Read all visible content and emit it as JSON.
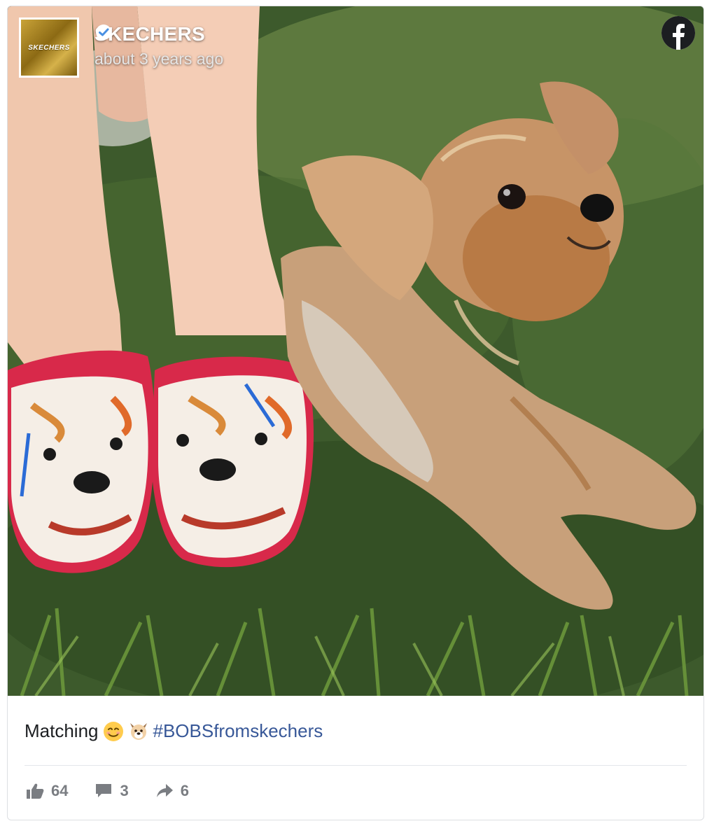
{
  "post": {
    "page_name": "SKECHERS",
    "avatar_text": "SKECHERS",
    "timestamp": "about 3 years ago",
    "caption_text": "Matching",
    "emojis": [
      "smiling-face-icon",
      "dog-face-icon"
    ],
    "hashtag": "#BOBSfromskechers",
    "verified": true
  },
  "stats": {
    "likes": "64",
    "comments": "3",
    "shares": "6"
  },
  "icons": {
    "network": "facebook-icon",
    "verified": "verified-badge-icon",
    "like": "thumbs-up-icon",
    "comment": "comment-icon",
    "share": "share-arrow-icon"
  },
  "colors": {
    "hashtag": "#385898",
    "facebook": "#1c1e21",
    "muted_text": "#7a7d82",
    "verified_blue": "#4a90e2"
  }
}
